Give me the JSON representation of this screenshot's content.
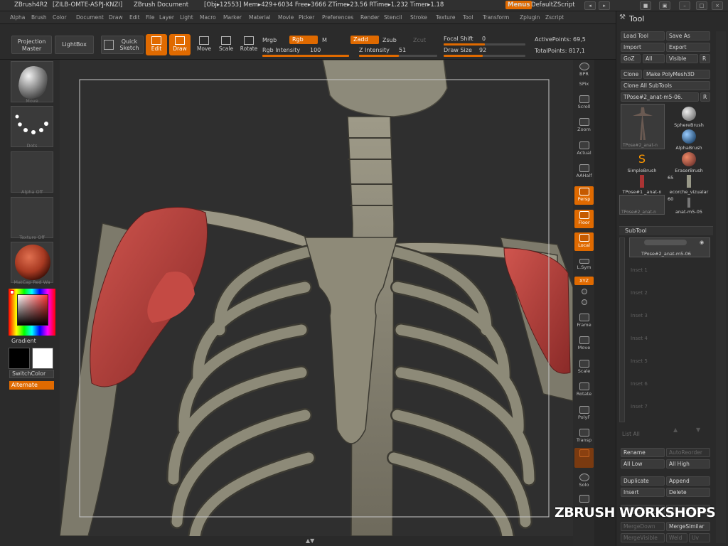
{
  "titlebar": {
    "app": "ZBrush4R2",
    "serial": "[ZILB-OMTE-ASPJ-KNZI]",
    "document": "ZBrush Document",
    "stats": "[Obj▸12553] Mem▸429+6034 Free▸3666 ZTime▸23.56 RTime▸1.232 Timer▸1.18",
    "menus": "Menus",
    "script": "DefaultZScript"
  },
  "menubar": [
    "Alpha",
    "Brush",
    "Color",
    "Document",
    "Draw",
    "Edit",
    "File",
    "Layer",
    "Light",
    "Macro",
    "Marker",
    "Material",
    "Movie",
    "Picker",
    "Preferences",
    "Render",
    "Stencil",
    "Stroke",
    "Texture",
    "Tool",
    "Transform",
    "Zplugin",
    "Zscript"
  ],
  "shelf": {
    "projection_master": "Projection Master",
    "lightbox": "LightBox",
    "quick_sketch": "Quick Sketch",
    "edit": "Edit",
    "draw": "Draw",
    "move": "Move",
    "scale": "Scale",
    "rotate": "Rotate",
    "mrgb": "Mrgb",
    "rgb": "Rgb",
    "m": "M",
    "rgb_intensity_label": "Rgb Intensity",
    "rgb_intensity_value": "100",
    "zadd": "Zadd",
    "zsub": "Zsub",
    "zcut": "Zcut",
    "z_intensity_label": "Z Intensity",
    "z_intensity_value": "51",
    "focal_shift_label": "Focal Shift",
    "focal_shift_value": "0",
    "draw_size_label": "Draw Size",
    "draw_size_value": "92",
    "active_points": "ActivePoints: 69,5",
    "total_points": "TotalPoints: 817,1"
  },
  "lefttray": {
    "brush_label": "Move",
    "stroke_label": "Dots",
    "alpha_label": "Alpha Off",
    "texture_label": "Texture Off",
    "material_label": "MatCap Red Wa",
    "gradient": "Gradient",
    "switchcolor": "SwitchColor",
    "alternate": "Alternate"
  },
  "rightshelf": [
    "BPR",
    "SPix",
    "Scroll",
    "Zoom",
    "Actual",
    "AAHalf",
    "Persp",
    "Floor",
    "Local",
    "L.Sym",
    "XYZ",
    "",
    "",
    "Frame",
    "Move",
    "Scale",
    "Rotate",
    "PolyF",
    "Transp",
    "",
    "Solo",
    ""
  ],
  "toolpanel": {
    "title": "Tool",
    "load_tool": "Load Tool",
    "save_as": "Save As",
    "import": "Import",
    "export": "Export",
    "goz": "GoZ",
    "all": "All",
    "visible": "Visible",
    "r": "R",
    "clone": "Clone",
    "make_polymesh": "Make PolyMesh3D",
    "clone_all": "Clone All SubTools",
    "current_tool": "TPose#2_anat-m5-06.",
    "brushes": [
      {
        "label": "TPose#2_anat-n",
        "number": ""
      },
      {
        "label": "SphereBrush",
        "number": ""
      },
      {
        "label": "AlphaBrush",
        "number": ""
      },
      {
        "label": "SimpleBrush",
        "number": ""
      },
      {
        "label": "EraserBrush",
        "number": ""
      },
      {
        "label": "TPose#1 _anat-n",
        "number": "65"
      },
      {
        "label": "ecorche_vizualar",
        "number": ""
      },
      {
        "label": "TPose#2_anat-n",
        "number": "60"
      },
      {
        "label": "anat-m5-05",
        "number": ""
      }
    ],
    "subtool_title": "SubTool",
    "subtool_item": "TPose#2_anat-m5-06",
    "inactive_slots": [
      "Inset 1",
      "Inset 2",
      "Inset 3",
      "Inset 4",
      "Inset 5",
      "Inset 6",
      "Inset 7"
    ],
    "list_all": "List All",
    "rename": "Rename",
    "autoreorder": "AutoReorder",
    "all_low": "All Low",
    "all_high": "All High",
    "duplicate": "Duplicate",
    "append": "Append",
    "insert": "Insert",
    "delete": "Delete",
    "split_hidden": "Split Hidden",
    "groups_split": "Groups Split",
    "merge_down": "MergeDown",
    "merge_similar": "MergeSimilar",
    "merge_visible": "MergeVisible",
    "weld": "Weld",
    "uv": "Uv"
  },
  "watermark": "ZBRUSH WORKSHOPS",
  "colors": {
    "accent": "#e06a00",
    "muscle": "#b8403c",
    "bone": "#8a8676"
  }
}
